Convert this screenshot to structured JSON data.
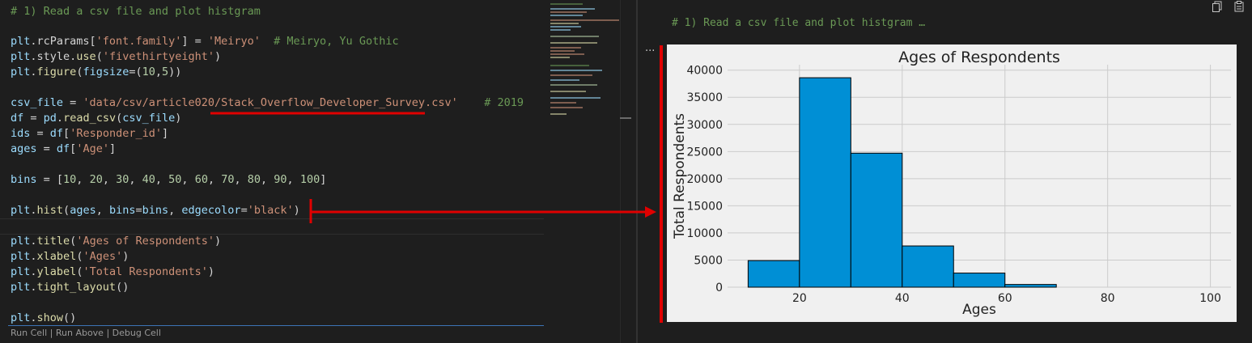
{
  "editor": {
    "lines": [
      {
        "top": 5,
        "tokens": [
          {
            "t": "# 1) Read a csv file and plot histgram",
            "c": "comment"
          }
        ]
      },
      {
        "top": 42,
        "tokens": [
          {
            "t": "plt",
            "c": "var"
          },
          {
            "t": ".rcParams[",
            "c": "plain"
          },
          {
            "t": "'font.family'",
            "c": "string"
          },
          {
            "t": "] = ",
            "c": "plain"
          },
          {
            "t": "'Meiryo'",
            "c": "string"
          },
          {
            "t": "  ",
            "c": "plain"
          },
          {
            "t": "# Meiryo, Yu Gothic",
            "c": "comment"
          }
        ]
      },
      {
        "top": 61,
        "tokens": [
          {
            "t": "plt",
            "c": "var"
          },
          {
            "t": ".style.",
            "c": "plain"
          },
          {
            "t": "use",
            "c": "fn"
          },
          {
            "t": "(",
            "c": "plain"
          },
          {
            "t": "'fivethirtyeight'",
            "c": "string"
          },
          {
            "t": ")",
            "c": "plain"
          }
        ]
      },
      {
        "top": 80,
        "tokens": [
          {
            "t": "plt",
            "c": "var"
          },
          {
            "t": ".",
            "c": "plain"
          },
          {
            "t": "figure",
            "c": "fn"
          },
          {
            "t": "(",
            "c": "plain"
          },
          {
            "t": "figsize",
            "c": "var"
          },
          {
            "t": "=(",
            "c": "plain"
          },
          {
            "t": "10",
            "c": "num"
          },
          {
            "t": ",",
            "c": "plain"
          },
          {
            "t": "5",
            "c": "num"
          },
          {
            "t": "))",
            "c": "plain"
          }
        ]
      },
      {
        "top": 118,
        "tokens": [
          {
            "t": "csv_file",
            "c": "var"
          },
          {
            "t": " = ",
            "c": "plain"
          },
          {
            "t": "'data/csv/article020/Stack_Overflow_Developer_Survey.csv'",
            "c": "string"
          },
          {
            "t": "    ",
            "c": "plain"
          },
          {
            "t": "# 2019",
            "c": "comment"
          }
        ]
      },
      {
        "top": 137,
        "tokens": [
          {
            "t": "df",
            "c": "var"
          },
          {
            "t": " = ",
            "c": "plain"
          },
          {
            "t": "pd",
            "c": "var"
          },
          {
            "t": ".",
            "c": "plain"
          },
          {
            "t": "read_csv",
            "c": "fn"
          },
          {
            "t": "(",
            "c": "plain"
          },
          {
            "t": "csv_file",
            "c": "var"
          },
          {
            "t": ")",
            "c": "plain"
          }
        ]
      },
      {
        "top": 156,
        "tokens": [
          {
            "t": "ids",
            "c": "var"
          },
          {
            "t": " = ",
            "c": "plain"
          },
          {
            "t": "df",
            "c": "var"
          },
          {
            "t": "[",
            "c": "plain"
          },
          {
            "t": "'Responder_id'",
            "c": "string"
          },
          {
            "t": "]",
            "c": "plain"
          }
        ]
      },
      {
        "top": 175,
        "tokens": [
          {
            "t": "ages",
            "c": "var"
          },
          {
            "t": " = ",
            "c": "plain"
          },
          {
            "t": "df",
            "c": "var"
          },
          {
            "t": "[",
            "c": "plain"
          },
          {
            "t": "'Age'",
            "c": "string"
          },
          {
            "t": "]",
            "c": "plain"
          }
        ]
      },
      {
        "top": 213,
        "tokens": [
          {
            "t": "bins",
            "c": "var"
          },
          {
            "t": " = [",
            "c": "plain"
          },
          {
            "t": "10",
            "c": "num"
          },
          {
            "t": ", ",
            "c": "plain"
          },
          {
            "t": "20",
            "c": "num"
          },
          {
            "t": ", ",
            "c": "plain"
          },
          {
            "t": "30",
            "c": "num"
          },
          {
            "t": ", ",
            "c": "plain"
          },
          {
            "t": "40",
            "c": "num"
          },
          {
            "t": ", ",
            "c": "plain"
          },
          {
            "t": "50",
            "c": "num"
          },
          {
            "t": ", ",
            "c": "plain"
          },
          {
            "t": "60",
            "c": "num"
          },
          {
            "t": ", ",
            "c": "plain"
          },
          {
            "t": "70",
            "c": "num"
          },
          {
            "t": ", ",
            "c": "plain"
          },
          {
            "t": "80",
            "c": "num"
          },
          {
            "t": ", ",
            "c": "plain"
          },
          {
            "t": "90",
            "c": "num"
          },
          {
            "t": ", ",
            "c": "plain"
          },
          {
            "t": "100",
            "c": "num"
          },
          {
            "t": "]",
            "c": "plain"
          }
        ]
      },
      {
        "top": 251,
        "tokens": [
          {
            "t": "plt",
            "c": "var"
          },
          {
            "t": ".",
            "c": "plain"
          },
          {
            "t": "hist",
            "c": "fn"
          },
          {
            "t": "(",
            "c": "plain"
          },
          {
            "t": "ages",
            "c": "var"
          },
          {
            "t": ", ",
            "c": "plain"
          },
          {
            "t": "bins",
            "c": "var"
          },
          {
            "t": "=",
            "c": "plain"
          },
          {
            "t": "bins",
            "c": "var"
          },
          {
            "t": ", ",
            "c": "plain"
          },
          {
            "t": "edgecolor",
            "c": "var"
          },
          {
            "t": "=",
            "c": "plain"
          },
          {
            "t": "'black'",
            "c": "string"
          },
          {
            "t": ")",
            "c": "plain"
          }
        ]
      },
      {
        "top": 289,
        "tokens": [
          {
            "t": "plt",
            "c": "var"
          },
          {
            "t": ".",
            "c": "plain"
          },
          {
            "t": "title",
            "c": "fn"
          },
          {
            "t": "(",
            "c": "plain"
          },
          {
            "t": "'Ages of Respondents'",
            "c": "string"
          },
          {
            "t": ")",
            "c": "plain"
          }
        ]
      },
      {
        "top": 308,
        "tokens": [
          {
            "t": "plt",
            "c": "var"
          },
          {
            "t": ".",
            "c": "plain"
          },
          {
            "t": "xlabel",
            "c": "fn"
          },
          {
            "t": "(",
            "c": "plain"
          },
          {
            "t": "'Ages'",
            "c": "string"
          },
          {
            "t": ")",
            "c": "plain"
          }
        ]
      },
      {
        "top": 327,
        "tokens": [
          {
            "t": "plt",
            "c": "var"
          },
          {
            "t": ".",
            "c": "plain"
          },
          {
            "t": "ylabel",
            "c": "fn"
          },
          {
            "t": "(",
            "c": "plain"
          },
          {
            "t": "'Total Respondents'",
            "c": "string"
          },
          {
            "t": ")",
            "c": "plain"
          }
        ]
      },
      {
        "top": 346,
        "tokens": [
          {
            "t": "plt",
            "c": "var"
          },
          {
            "t": ".",
            "c": "plain"
          },
          {
            "t": "tight_layout",
            "c": "fn"
          },
          {
            "t": "()",
            "c": "plain"
          }
        ]
      },
      {
        "top": 384,
        "tokens": [
          {
            "t": "plt",
            "c": "var"
          },
          {
            "t": ".",
            "c": "plain"
          },
          {
            "t": "show",
            "c": "fn"
          },
          {
            "t": "()",
            "c": "plain"
          }
        ]
      }
    ],
    "codelens": "Run Cell | Run Above | Debug Cell"
  },
  "output": {
    "header": "# 1) Read a csv file and plot histgram …",
    "more": "...",
    "icons": [
      "copy-icon",
      "paste-icon"
    ]
  },
  "colors": {
    "comment": "#6a9955",
    "string": "#ce9178",
    "variable": "#9cdcfe",
    "number": "#b5cea8",
    "function": "#dcdcaa",
    "annotation_red": "#e00000",
    "bar_fill": "#008fd5",
    "plot_bg": "#f0f0f0"
  },
  "chart_data": {
    "type": "bar",
    "title": "Ages of Respondents",
    "xlabel": "Ages",
    "ylabel": "Total Respondents",
    "bins": [
      10,
      20,
      30,
      40,
      50,
      60,
      70,
      80,
      90,
      100
    ],
    "values": [
      4900,
      38600,
      24700,
      7600,
      2600,
      500,
      0,
      0,
      0
    ],
    "xticks": [
      20,
      40,
      60,
      80,
      100
    ],
    "yticks": [
      0,
      5000,
      10000,
      15000,
      20000,
      25000,
      30000,
      35000,
      40000
    ],
    "xlim": [
      6,
      104
    ],
    "ylim": [
      0,
      41000
    ],
    "grid": true
  }
}
